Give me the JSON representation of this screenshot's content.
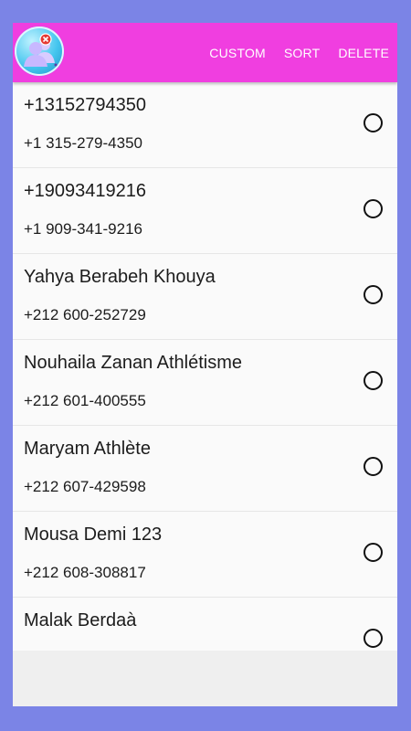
{
  "toolbar": {
    "actions": [
      "CUSTOM",
      "SORT",
      "DELETE"
    ]
  },
  "contacts": [
    {
      "name": "+13152794350",
      "phone": "+1 315-279-4350"
    },
    {
      "name": "+19093419216",
      "phone": "+1 909-341-9216"
    },
    {
      "name": "Yahya Berabeh Khouya",
      "phone": "+212 600-252729"
    },
    {
      "name": "Nouhaila Zanan Athlétisme",
      "phone": "+212 601-400555"
    },
    {
      "name": "Maryam Athlète",
      "phone": "+212 607-429598"
    },
    {
      "name": "Mousa Demi 123",
      "phone": "+212 608-308817"
    },
    {
      "name": "Malak Berdaà",
      "phone": ""
    }
  ],
  "icons": {
    "app": "contacts-delete-icon",
    "radio": "radio-unchecked-icon"
  },
  "colors": {
    "background": "#7b84e6",
    "toolbar": "#f03ee0",
    "delete_badge": "#e53935"
  }
}
